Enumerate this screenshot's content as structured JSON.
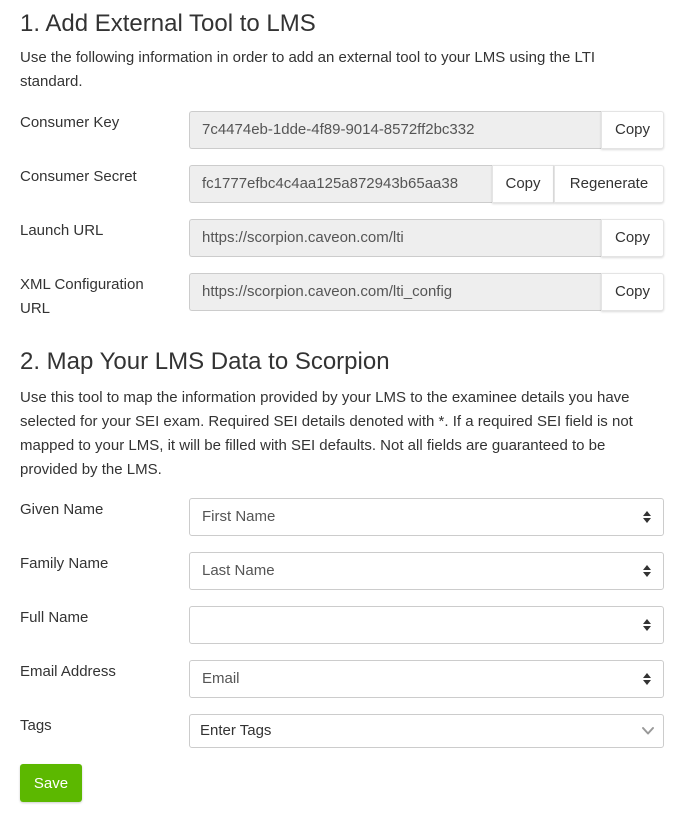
{
  "section1": {
    "title": "1. Add External Tool to LMS",
    "description": "Use the following information in order to add an external tool to your LMS using the LTI standard."
  },
  "fields": {
    "consumer_key": {
      "label": "Consumer Key",
      "value": "7c4474eb-1dde-4f89-9014-8572ff2bc332",
      "copy": "Copy"
    },
    "consumer_secret": {
      "label": "Consumer Secret",
      "value": "fc1777efbc4c4aa125a872943b65aa38",
      "copy": "Copy",
      "regenerate": "Regenerate"
    },
    "launch_url": {
      "label": "Launch URL",
      "value": "https://scorpion.caveon.com/lti",
      "copy": "Copy"
    },
    "xml_config": {
      "label_line1": "XML Configuration",
      "label_line2": "URL",
      "value": "https://scorpion.caveon.com/lti_config",
      "copy": "Copy"
    }
  },
  "section2": {
    "title": "2. Map Your LMS Data to Scorpion",
    "description": "Use this tool to map the information provided by your LMS to the examinee details you have selected for your SEI exam. Required SEI details denoted with *. If a required SEI field is not mapped to your LMS, it will be filled with SEI defaults. Not all fields are guaranteed to be provided by the LMS."
  },
  "mapping": {
    "given_name": {
      "label": "Given Name",
      "selected": "First Name"
    },
    "family_name": {
      "label": "Family Name",
      "selected": "Last Name"
    },
    "full_name": {
      "label": "Full Name",
      "selected": ""
    },
    "email": {
      "label": "Email Address",
      "selected": "Email"
    },
    "tags": {
      "label": "Tags",
      "placeholder": "Enter Tags"
    }
  },
  "save_label": "Save",
  "colors": {
    "accent": "#5cb800",
    "readonly_bg": "#eeeeee",
    "border": "#cccccc"
  },
  "icons": {
    "select_caret": "sort-caret-icon",
    "tags_dropdown": "chevron-down-icon"
  }
}
